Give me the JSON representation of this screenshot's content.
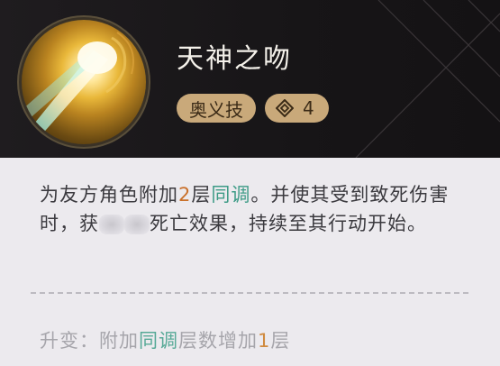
{
  "skill": {
    "name": "天神之吻",
    "icon": "golden-light-beam-icon",
    "type_tag": "奥义技",
    "cost_icon": "diamond-cost-icon",
    "cost": "4"
  },
  "description": {
    "p1": "为友方角色附加",
    "n1": "2",
    "p2": "层",
    "term1": "同调",
    "p3": "。并使其受到致死伤害时，获",
    "p4": "死亡效果，持续至其行动开始。"
  },
  "upgrade": {
    "prefix": "升变：附加",
    "term": "同调",
    "middle": "层数增加",
    "number": "1",
    "suffix": "层"
  },
  "colors": {
    "header_bg": "#171517",
    "tag_bg": "#c9a97a",
    "number_highlight": "#c9702a",
    "term_highlight": "#3d9b86"
  }
}
